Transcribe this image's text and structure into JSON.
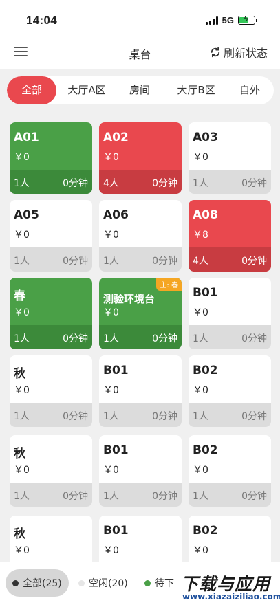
{
  "status": {
    "time": "14:04",
    "network": "5G"
  },
  "nav": {
    "title": "桌台",
    "refresh_label": "刷新状态"
  },
  "tabs": [
    {
      "label": "全部",
      "active": true
    },
    {
      "label": "大厅A区",
      "active": false
    },
    {
      "label": "房间",
      "active": false
    },
    {
      "label": "大厅B区",
      "active": false
    },
    {
      "label": "自外",
      "active": false
    }
  ],
  "tables": [
    {
      "name": "A01",
      "price": "￥0",
      "people": "1人",
      "minutes": "0分钟",
      "status": "green"
    },
    {
      "name": "A02",
      "price": "￥0",
      "people": "4人",
      "minutes": "0分钟",
      "status": "red"
    },
    {
      "name": "A03",
      "price": "￥0",
      "people": "1人",
      "minutes": "0分钟",
      "status": "idle"
    },
    {
      "name": "A05",
      "price": "￥0",
      "people": "1人",
      "minutes": "0分钟",
      "status": "idle"
    },
    {
      "name": "A06",
      "price": "￥0",
      "people": "1人",
      "minutes": "0分钟",
      "status": "idle"
    },
    {
      "name": "A08",
      "price": "￥8",
      "people": "4人",
      "minutes": "0分钟",
      "status": "red"
    },
    {
      "name": "春",
      "price": "￥0",
      "people": "1人",
      "minutes": "0分钟",
      "status": "green"
    },
    {
      "name": "测验环境台",
      "price": "￥0",
      "people": "1人",
      "minutes": "0分钟",
      "status": "green",
      "badge": "主: 春"
    },
    {
      "name": "B01",
      "price": "￥0",
      "people": "1人",
      "minutes": "0分钟",
      "status": "idle"
    },
    {
      "name": "秋",
      "price": "￥0",
      "people": "1人",
      "minutes": "0分钟",
      "status": "idle"
    },
    {
      "name": "B01",
      "price": "￥0",
      "people": "1人",
      "minutes": "0分钟",
      "status": "idle"
    },
    {
      "name": "B02",
      "price": "￥0",
      "people": "1人",
      "minutes": "0分钟",
      "status": "idle"
    },
    {
      "name": "秋",
      "price": "￥0",
      "people": "1人",
      "minutes": "0分钟",
      "status": "idle"
    },
    {
      "name": "B01",
      "price": "￥0",
      "people": "1人",
      "minutes": "0分钟",
      "status": "idle"
    },
    {
      "name": "B02",
      "price": "￥0",
      "people": "1人",
      "minutes": "0分钟",
      "status": "idle"
    },
    {
      "name": "秋",
      "price": "￥0",
      "people": "",
      "minutes": "",
      "status": "idle"
    },
    {
      "name": "B01",
      "price": "￥0",
      "people": "",
      "minutes": "",
      "status": "idle"
    },
    {
      "name": "B02",
      "price": "￥0",
      "people": "",
      "minutes": "",
      "status": "idle"
    }
  ],
  "filters": [
    {
      "label": "全部(25)",
      "dot_color": "#333333",
      "active": true
    },
    {
      "label": "空闲(20)",
      "dot_color": "#e6e6e6",
      "active": false
    },
    {
      "label": "待下",
      "dot_color": "#4aa047",
      "active": false
    }
  ],
  "watermark": {
    "title": "下载与应用",
    "url": "www.xiazaiziliao.com"
  },
  "colors": {
    "accent": "#e9484e",
    "occupied_green": "#4aa047",
    "occupied_red": "#e9484e",
    "badge": "#f5a623"
  }
}
